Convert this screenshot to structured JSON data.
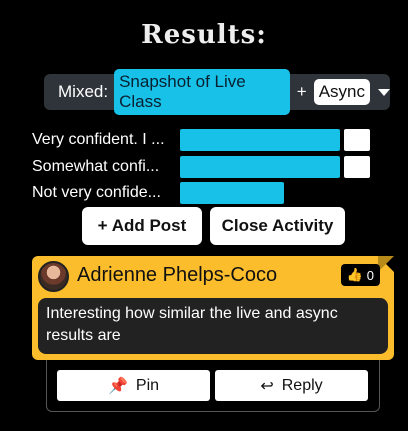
{
  "title": "Results:",
  "filter": {
    "label": "Mixed:",
    "option_a": "Snapshot of Live Class",
    "joiner": "+",
    "option_b": "Async"
  },
  "results": [
    {
      "label": "Very confident. I ...",
      "live": 0.86,
      "async": 0.14
    },
    {
      "label": "Somewhat confi...",
      "live": 0.86,
      "async": 0.14
    },
    {
      "label": "Not very confide...",
      "live": 0.56,
      "async": 0
    }
  ],
  "buttons": {
    "add_post": "+ Add Post",
    "close_activity": "Close Activity"
  },
  "post": {
    "author": "Adrienne Phelps-Coco",
    "likes": "0",
    "message": "Interesting how similar the live and async results are",
    "pin_label": "Pin",
    "reply_label": "Reply"
  },
  "colors": {
    "accent": "#17c1e8",
    "card": "#fbbd2c",
    "filter_bg": "#2f343b"
  }
}
